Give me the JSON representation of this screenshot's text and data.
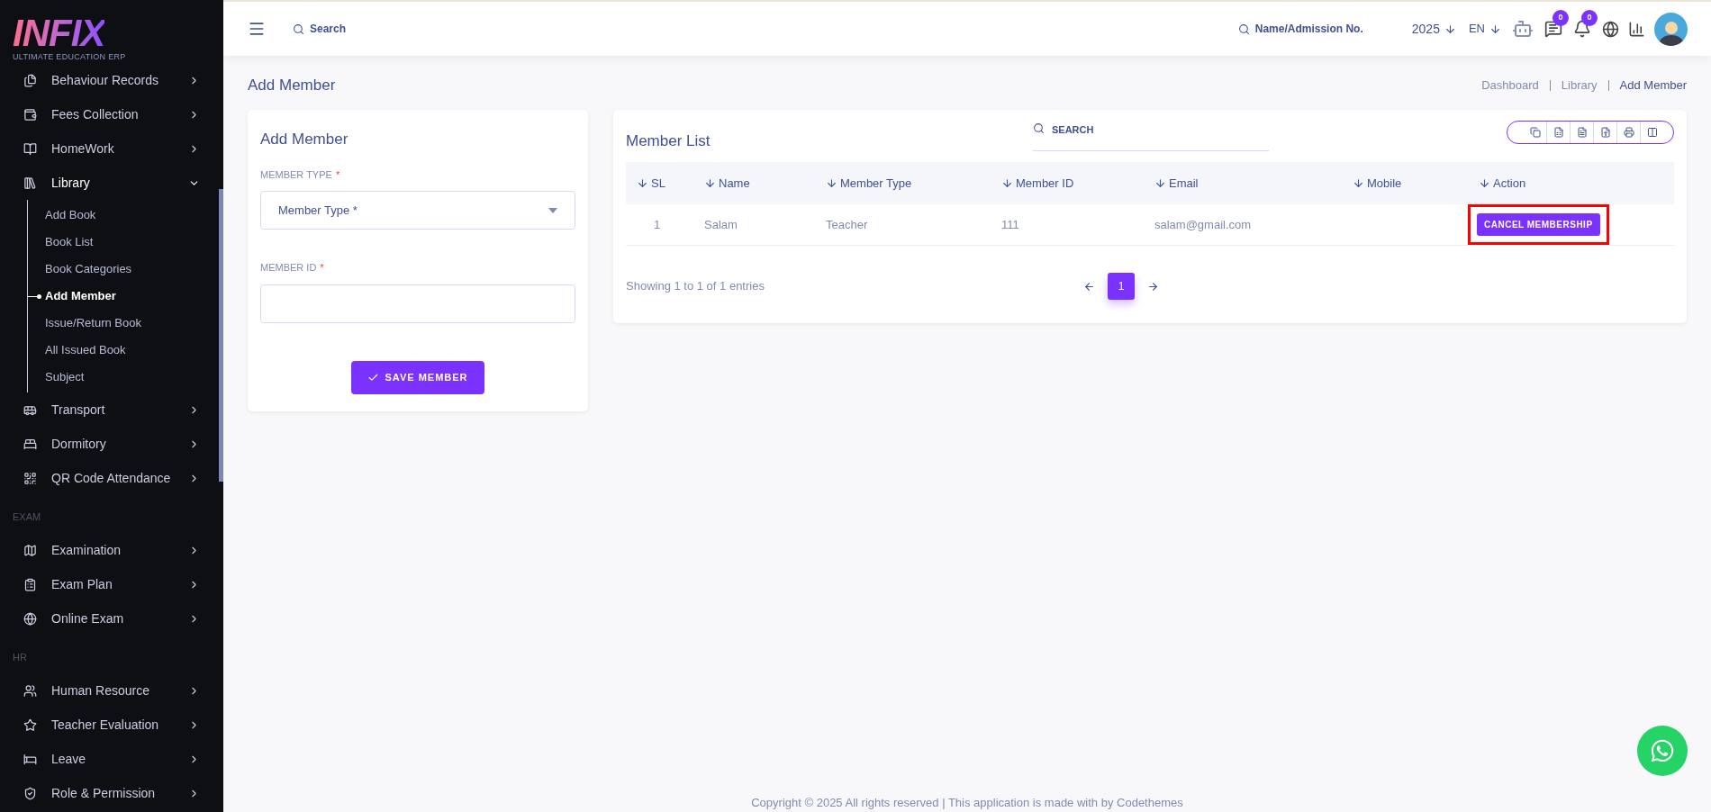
{
  "logo": {
    "wordmark": "INFIX",
    "tagline": "ULTIMATE EDUCATION ERP"
  },
  "sidebar": {
    "groups": [
      {
        "items": [
          {
            "label": "Behaviour Records",
            "expanded": false
          },
          {
            "label": "Fees Collection",
            "expanded": false
          },
          {
            "label": "HomeWork",
            "expanded": false
          },
          {
            "label": "Library",
            "expanded": true,
            "children": [
              {
                "label": "Add Book",
                "selected": false
              },
              {
                "label": "Book List",
                "selected": false
              },
              {
                "label": "Book Categories",
                "selected": false
              },
              {
                "label": "Add Member",
                "selected": true
              },
              {
                "label": "Issue/Return Book",
                "selected": false
              },
              {
                "label": "All Issued Book",
                "selected": false
              },
              {
                "label": "Subject",
                "selected": false
              }
            ]
          },
          {
            "label": "Transport",
            "expanded": false
          },
          {
            "label": "Dormitory",
            "expanded": false
          },
          {
            "label": "QR Code Attendance",
            "expanded": false
          }
        ]
      },
      {
        "heading": "EXAM",
        "items": [
          {
            "label": "Examination",
            "expanded": false
          },
          {
            "label": "Exam Plan",
            "expanded": false
          },
          {
            "label": "Online Exam",
            "expanded": false
          }
        ]
      },
      {
        "heading": "HR",
        "items": [
          {
            "label": "Human Resource",
            "expanded": false
          },
          {
            "label": "Teacher Evaluation",
            "expanded": false
          },
          {
            "label": "Leave",
            "expanded": false
          },
          {
            "label": "Role & Permission",
            "expanded": false
          }
        ]
      }
    ]
  },
  "header": {
    "search": {
      "placeholder": "Search"
    },
    "student_search": {
      "placeholder": "Name/Admission No."
    },
    "year": "2025",
    "language": "EN",
    "messages_badge": "0",
    "notifications_badge": "0"
  },
  "page": {
    "title": "Add Member",
    "breadcrumb": [
      "Dashboard",
      "Library",
      "Add Member"
    ]
  },
  "form": {
    "title": "Add Member",
    "fields": [
      {
        "kind": "select",
        "label": "MEMBER TYPE",
        "required_mark": "*",
        "placeholder": "Member Type *"
      },
      {
        "kind": "text",
        "label": "MEMBER ID",
        "required_mark": "*"
      }
    ],
    "submit": "SAVE MEMBER"
  },
  "member_list": {
    "title": "Member List",
    "search": {
      "placeholder": "SEARCH"
    },
    "columns": [
      "SL",
      "Name",
      "Member Type",
      "Member ID",
      "Email",
      "Mobile",
      "Action"
    ],
    "rows": [
      {
        "sl": "1",
        "name": "Salam",
        "member_type": "Teacher",
        "member_id": "111",
        "email": "salam@gmail.com",
        "action": "CANCEL MEMBERSHIP",
        "highlighted": true
      }
    ],
    "info": "Showing 1 to 1 of 1 entries",
    "pages": [
      {
        "label": "1",
        "selected": true
      }
    ]
  },
  "footer": "Copyright © 2025 All rights reserved | This application is made with by Codethemes"
}
